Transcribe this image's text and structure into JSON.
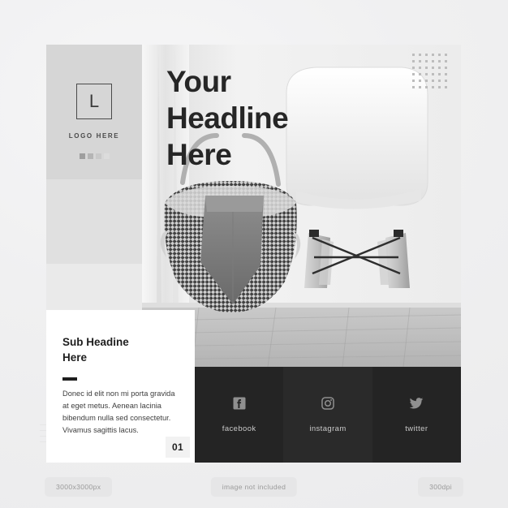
{
  "background_color": "#f1f1f2",
  "logo_panel": {
    "mark_letter": "L",
    "caption": "LOGO HERE",
    "swatches": [
      "#9e9e9e",
      "#b5b5b5",
      "#c9c9c9",
      "#dcdcdc"
    ]
  },
  "headline": {
    "line1": "Your",
    "line2": "Headline",
    "line3": "Here",
    "color": "#262626"
  },
  "photo": {
    "alt": "black and white interior photo with woven basket and chair",
    "subject": "woven-basket-and-eames-chair"
  },
  "card": {
    "title_line1": "Sub Headine",
    "title_line2": "Here",
    "body": "Donec id elit non mi porta gravida at eget metus. Aenean lacinia bibendum nulla sed consectetur. Vivamus sagittis lacus.",
    "number": "01"
  },
  "social_bar": {
    "background": "#242424",
    "items": [
      {
        "icon": "facebook-icon",
        "label": "facebook"
      },
      {
        "icon": "instagram-icon",
        "label": "instagram"
      },
      {
        "icon": "twitter-icon",
        "label": "twitter"
      }
    ]
  },
  "pills": [
    {
      "label": "3000x3000px"
    },
    {
      "label": "image not included"
    },
    {
      "label": "300dpi"
    }
  ]
}
